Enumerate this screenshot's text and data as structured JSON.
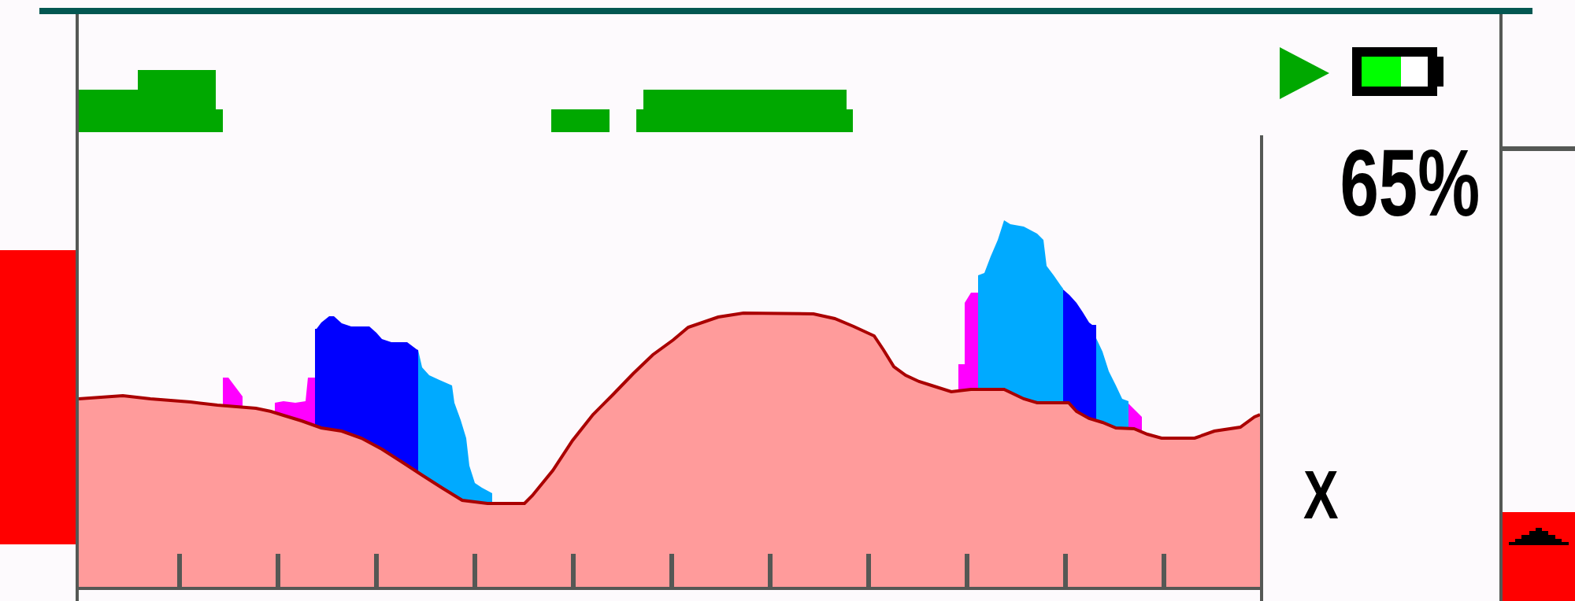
{
  "status": {
    "battery_text": "65%"
  },
  "side_panel": {
    "label": "X"
  }
}
